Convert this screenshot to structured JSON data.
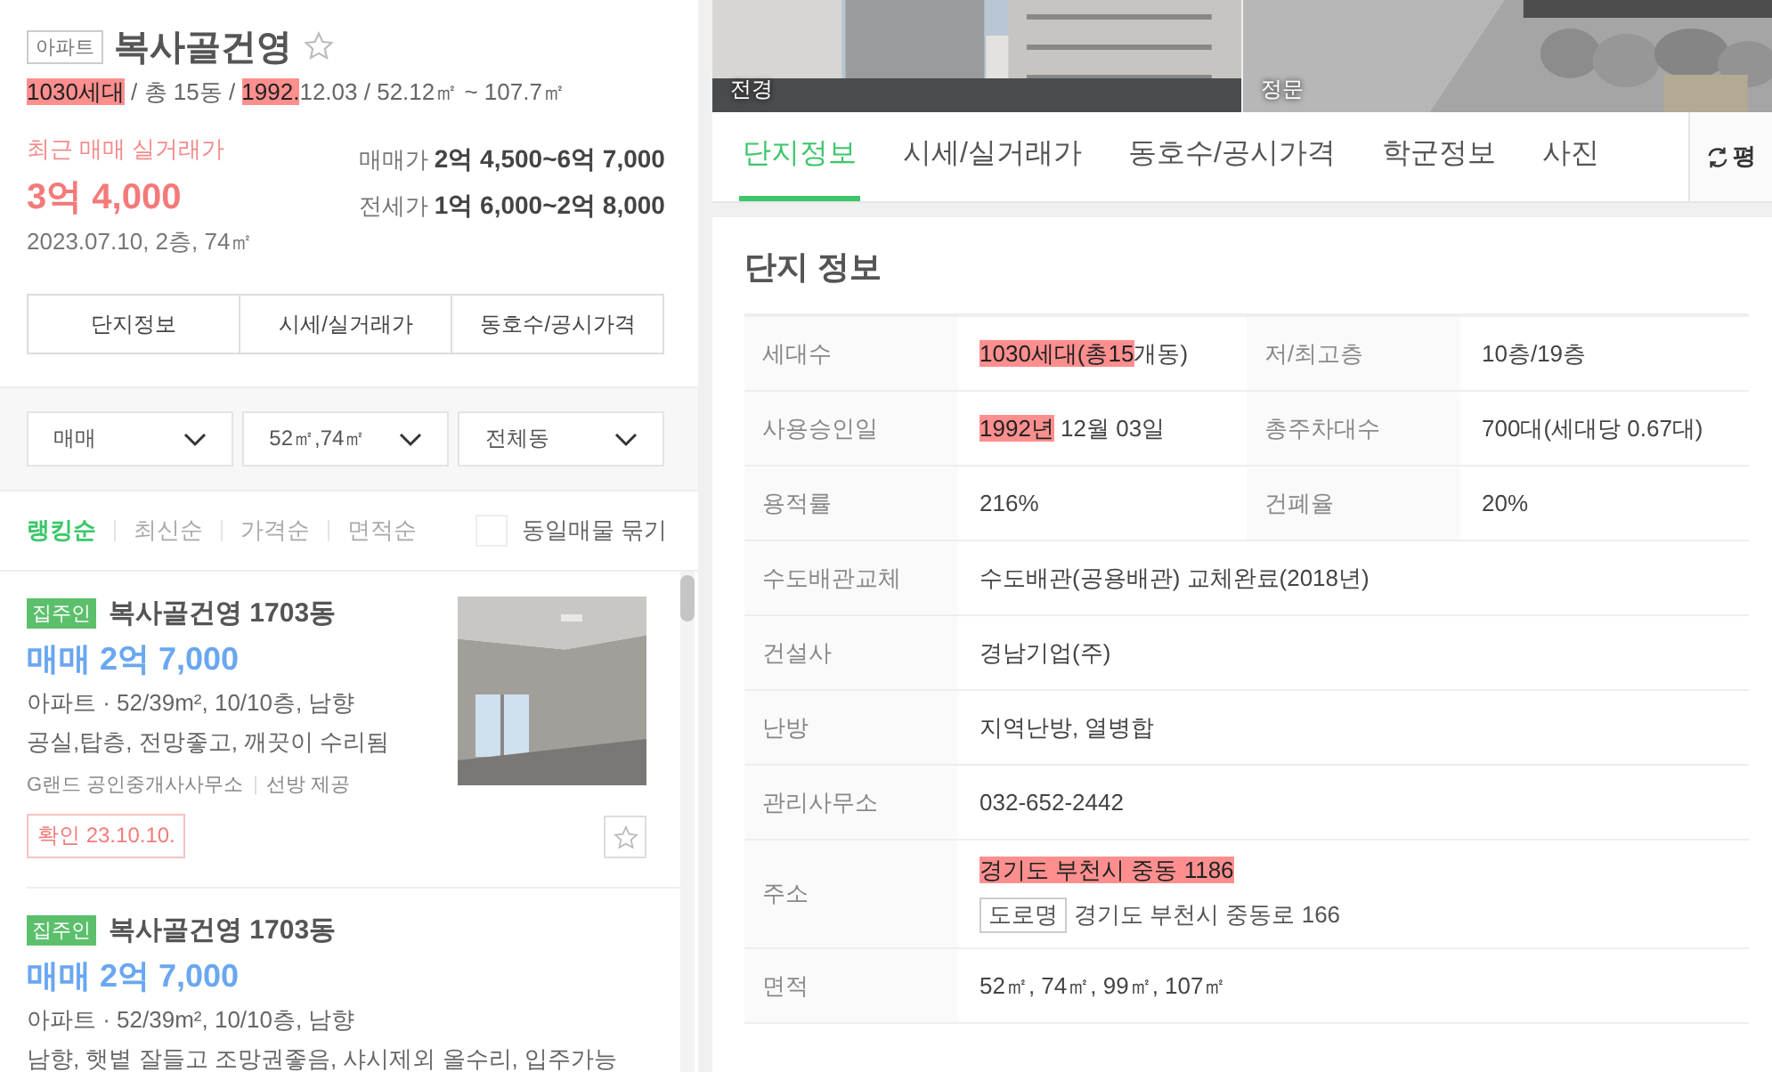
{
  "complex": {
    "type_badge": "아파트",
    "name": "복사골건영",
    "favorite": false,
    "summary": [
      {
        "text": "1030세대",
        "highlighted": true
      },
      {
        "text": " / 총 15동 / ",
        "highlighted": false
      },
      {
        "text": "1992.",
        "highlighted": true
      },
      {
        "text": "12.03 / 52.12㎡ ~ 107.7㎡",
        "highlighted": false
      }
    ]
  },
  "recent_deal": {
    "label": "최근 매매 실거래가",
    "price": "3억 4,000",
    "detail": "2023.07.10, 2층, 74㎡"
  },
  "price_ranges": [
    {
      "label": "매매가",
      "value": "2억 4,500~6억 7,000"
    },
    {
      "label": "전세가",
      "value": "1억 6,000~2억 8,000"
    }
  ],
  "quick_tabs": [
    "단지정보",
    "시세/실거래가",
    "동호수/공시가격"
  ],
  "filters": [
    {
      "value": "매매"
    },
    {
      "value": "52㎡,74㎡"
    },
    {
      "value": "전체동"
    }
  ],
  "sort_options": [
    {
      "label": "랭킹순",
      "selected": true
    },
    {
      "label": "최신순",
      "selected": false
    },
    {
      "label": "가격순",
      "selected": false
    },
    {
      "label": "면적순",
      "selected": false
    }
  ],
  "group_same": {
    "label": "동일매물 묶기",
    "checked": false
  },
  "listings": [
    {
      "badge": "집주인",
      "title": "복사골건영 1703동",
      "price": "매매 2억 7,000",
      "spec": "아파트 · 52/39m², 10/10층, 남향",
      "description": "공실,탑층, 전망좋고, 깨끗이 수리됨",
      "agency": "G랜드 공인중개사사무소",
      "provider": "선방 제공",
      "confirm_label": "확인",
      "confirm_date": "23.10.10.",
      "favorite": false
    },
    {
      "badge": "집주인",
      "title": "복사골건영 1703동",
      "price": "매매 2억 7,000",
      "spec": "아파트 · 52/39m², 10/10층, 남향",
      "description": "남향, 햇볕 잘들고 조망권좋음, 샤시제외 올수리, 입주가능"
    }
  ],
  "photos": [
    {
      "caption": "전경",
      "kind": "building"
    },
    {
      "caption": "정문",
      "kind": "entrance"
    }
  ],
  "tabs": [
    {
      "label": "단지정보",
      "selected": true
    },
    {
      "label": "시세/실거래가",
      "selected": false
    },
    {
      "label": "동호수/공시가격",
      "selected": false
    },
    {
      "label": "학군정보",
      "selected": false
    },
    {
      "label": "사진",
      "selected": false
    }
  ],
  "unit_toggle": "평",
  "section_title": "단지 정보",
  "info_rows": [
    {
      "cells": [
        {
          "label": "세대수",
          "value": [
            {
              "text": "1030세대(총15",
              "highlighted": true
            },
            {
              "text": "개동)",
              "highlighted": false
            }
          ]
        },
        {
          "label": "저/최고층",
          "value": "10층/19층"
        }
      ]
    },
    {
      "cells": [
        {
          "label": "사용승인일",
          "value": [
            {
              "text": "1992년",
              "highlighted": true
            },
            {
              "text": " 12월 03일",
              "highlighted": false
            }
          ]
        },
        {
          "label": "총주차대수",
          "value": "700대(세대당 0.67대)"
        }
      ]
    },
    {
      "cells": [
        {
          "label": "용적률",
          "value": "216%"
        },
        {
          "label": "건폐율",
          "value": "20%"
        }
      ]
    },
    {
      "cells": [
        {
          "label": "수도배관교체",
          "value": "수도배관(공용배관) 교체완료(2018년)"
        }
      ]
    },
    {
      "cells": [
        {
          "label": "건설사",
          "value": "경남기업(주)"
        }
      ]
    },
    {
      "cells": [
        {
          "label": "난방",
          "value": "지역난방, 열병합"
        }
      ]
    },
    {
      "cells": [
        {
          "label": "관리사무소",
          "value": "032-652-2442"
        }
      ]
    },
    {
      "cells": [
        {
          "label": "주소",
          "value": [
            {
              "text": "경기도 부천시 중동 1186",
              "highlighted": true
            }
          ],
          "road": {
            "badge": "도로명",
            "address": "경기도 부천시 중동로 166"
          }
        }
      ]
    },
    {
      "cells": [
        {
          "label": "면적",
          "value": "52㎡, 74㎡, 99㎡, 107㎡"
        }
      ]
    }
  ]
}
